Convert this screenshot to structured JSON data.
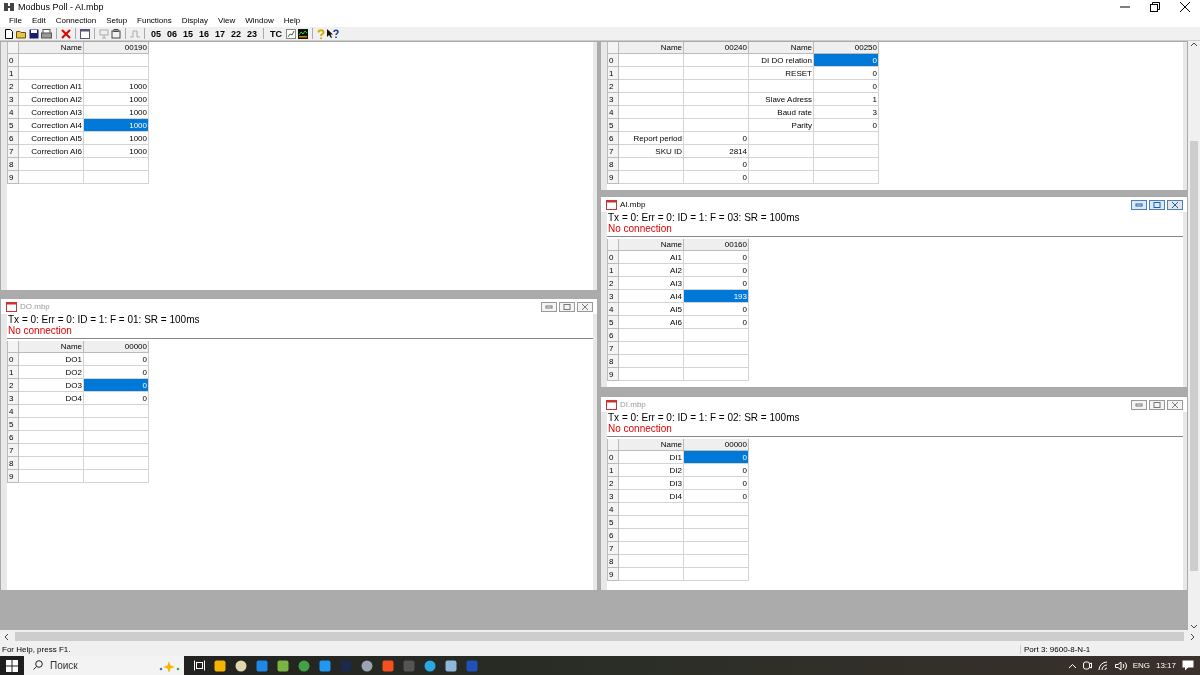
{
  "window": {
    "title": "Modbus Poll - AI.mbp"
  },
  "menu": [
    "File",
    "Edit",
    "Connection",
    "Setup",
    "Functions",
    "Display",
    "View",
    "Window",
    "Help"
  ],
  "toolbar": {
    "function_codes": [
      "05",
      "06",
      "15",
      "16",
      "17",
      "22",
      "23"
    ],
    "tc": "TC"
  },
  "documents": [
    {
      "columns": [
        {
          "name": "Name",
          "address": "00190"
        }
      ],
      "rows": [
        {
          "number": "0",
          "cells": [
            {
              "selected": false
            }
          ]
        },
        {
          "number": "1",
          "cells": [
            {
              "selected": false
            }
          ]
        },
        {
          "number": "2",
          "cells": [
            {
              "name": "Correction AI1",
              "value": "1000",
              "selected": false
            }
          ]
        },
        {
          "number": "3",
          "cells": [
            {
              "name": "Correction AI2",
              "value": "1000",
              "selected": false
            }
          ]
        },
        {
          "number": "4",
          "cells": [
            {
              "name": "Correction AI3",
              "value": "1000",
              "selected": false
            }
          ]
        },
        {
          "number": "5",
          "cells": [
            {
              "name": "Correction AI4",
              "value": "1000",
              "selected": true
            }
          ]
        },
        {
          "number": "6",
          "cells": [
            {
              "name": "Correction AI5",
              "value": "1000",
              "selected": false
            }
          ]
        },
        {
          "number": "7",
          "cells": [
            {
              "name": "Correction AI6",
              "value": "1000",
              "selected": false
            }
          ]
        },
        {
          "number": "8",
          "cells": [
            {
              "selected": false
            }
          ]
        },
        {
          "number": "9",
          "cells": [
            {
              "selected": false
            }
          ]
        }
      ]
    },
    {
      "columns": [
        {
          "name": "Name",
          "address": "00240"
        },
        {
          "name": "Name",
          "address": "00250"
        }
      ],
      "rows": [
        {
          "number": "0",
          "cells": [
            {
              "selected": false
            },
            {
              "name": "DI DO relation",
              "value": "0",
              "selected": true
            }
          ]
        },
        {
          "number": "1",
          "cells": [
            {
              "selected": false
            },
            {
              "name": "RESET",
              "value": "0",
              "selected": false
            }
          ]
        },
        {
          "number": "2",
          "cells": [
            {
              "selected": false
            },
            {
              "value": "0",
              "selected": false
            }
          ]
        },
        {
          "number": "3",
          "cells": [
            {
              "selected": false
            },
            {
              "name": "Slave Adress",
              "value": "1",
              "selected": false
            }
          ]
        },
        {
          "number": "4",
          "cells": [
            {
              "selected": false
            },
            {
              "name": "Baud rate",
              "value": "3",
              "selected": false
            }
          ]
        },
        {
          "number": "5",
          "cells": [
            {
              "selected": false
            },
            {
              "name": "Parity",
              "value": "0",
              "selected": false
            }
          ]
        },
        {
          "number": "6",
          "cells": [
            {
              "name": "Report period",
              "value": "0",
              "selected": false
            },
            {
              "selected": false
            }
          ]
        },
        {
          "number": "7",
          "cells": [
            {
              "name": "SKU ID",
              "value": "2814",
              "selected": false
            },
            {
              "selected": false
            }
          ]
        },
        {
          "number": "8",
          "cells": [
            {
              "value": "0",
              "selected": false
            },
            {
              "selected": false
            }
          ]
        },
        {
          "number": "9",
          "cells": [
            {
              "value": "0",
              "selected": false
            },
            {
              "selected": false
            }
          ]
        }
      ]
    },
    {
      "title": "AI.mbp",
      "active": true,
      "status": "Tx = 0: Err = 0: ID = 1: F = 03: SR = 100ms",
      "connection": "No connection",
      "columns": [
        {
          "name": "Name",
          "address": "00160"
        }
      ],
      "rows": [
        {
          "number": "0",
          "cells": [
            {
              "name": "AI1",
              "value": "0",
              "selected": false
            }
          ]
        },
        {
          "number": "1",
          "cells": [
            {
              "name": "AI2",
              "value": "0",
              "selected": false
            }
          ]
        },
        {
          "number": "2",
          "cells": [
            {
              "name": "AI3",
              "value": "0",
              "selected": false
            }
          ]
        },
        {
          "number": "3",
          "cells": [
            {
              "name": "AI4",
              "value": "193",
              "selected": true
            }
          ]
        },
        {
          "number": "4",
          "cells": [
            {
              "name": "AI5",
              "value": "0",
              "selected": false
            }
          ]
        },
        {
          "number": "5",
          "cells": [
            {
              "name": "AI6",
              "value": "0",
              "selected": false
            }
          ]
        },
        {
          "number": "6",
          "cells": [
            {
              "selected": false
            }
          ]
        },
        {
          "number": "7",
          "cells": [
            {
              "selected": false
            }
          ]
        },
        {
          "number": "8",
          "cells": [
            {
              "selected": false
            }
          ]
        },
        {
          "number": "9",
          "cells": [
            {
              "selected": false
            }
          ]
        }
      ]
    },
    {
      "title": "DO.mbp",
      "active": false,
      "status": "Tx = 0: Err = 0: ID = 1: F = 01: SR = 100ms",
      "connection": "No connection",
      "columns": [
        {
          "name": "Name",
          "address": "00000"
        }
      ],
      "rows": [
        {
          "number": "0",
          "cells": [
            {
              "name": "DO1",
              "value": "0",
              "selected": false
            }
          ]
        },
        {
          "number": "1",
          "cells": [
            {
              "name": "DO2",
              "value": "0",
              "selected": false
            }
          ]
        },
        {
          "number": "2",
          "cells": [
            {
              "name": "DO3",
              "value": "0",
              "selected": true
            }
          ]
        },
        {
          "number": "3",
          "cells": [
            {
              "name": "DO4",
              "value": "0",
              "selected": false
            }
          ]
        },
        {
          "number": "4",
          "cells": [
            {
              "selected": false
            }
          ]
        },
        {
          "number": "5",
          "cells": [
            {
              "selected": false
            }
          ]
        },
        {
          "number": "6",
          "cells": [
            {
              "selected": false
            }
          ]
        },
        {
          "number": "7",
          "cells": [
            {
              "selected": false
            }
          ]
        },
        {
          "number": "8",
          "cells": [
            {
              "selected": false
            }
          ]
        },
        {
          "number": "9",
          "cells": [
            {
              "selected": false
            }
          ]
        }
      ]
    },
    {
      "title": "DI.mbp",
      "active": false,
      "status": "Tx = 0: Err = 0: ID = 1: F = 02: SR = 100ms",
      "connection": "No connection",
      "columns": [
        {
          "name": "Name",
          "address": "00000"
        }
      ],
      "rows": [
        {
          "number": "0",
          "cells": [
            {
              "name": "DI1",
              "value": "0",
              "selected": true
            }
          ]
        },
        {
          "number": "1",
          "cells": [
            {
              "name": "DI2",
              "value": "0",
              "selected": false
            }
          ]
        },
        {
          "number": "2",
          "cells": [
            {
              "name": "DI3",
              "value": "0",
              "selected": false
            }
          ]
        },
        {
          "number": "3",
          "cells": [
            {
              "name": "DI4",
              "value": "0",
              "selected": false
            }
          ]
        },
        {
          "number": "4",
          "cells": [
            {
              "selected": false
            }
          ]
        },
        {
          "number": "5",
          "cells": [
            {
              "selected": false
            }
          ]
        },
        {
          "number": "6",
          "cells": [
            {
              "selected": false
            }
          ]
        },
        {
          "number": "7",
          "cells": [
            {
              "selected": false
            }
          ]
        },
        {
          "number": "8",
          "cells": [
            {
              "selected": false
            }
          ]
        },
        {
          "number": "9",
          "cells": [
            {
              "selected": false
            }
          ]
        }
      ]
    }
  ],
  "status_bar": {
    "help": "For Help, press F1.",
    "port": "Port 3: 9600-8-N-1"
  },
  "taskbar": {
    "search_placeholder": "Поиск",
    "language": "ENG",
    "time": "13:17"
  }
}
